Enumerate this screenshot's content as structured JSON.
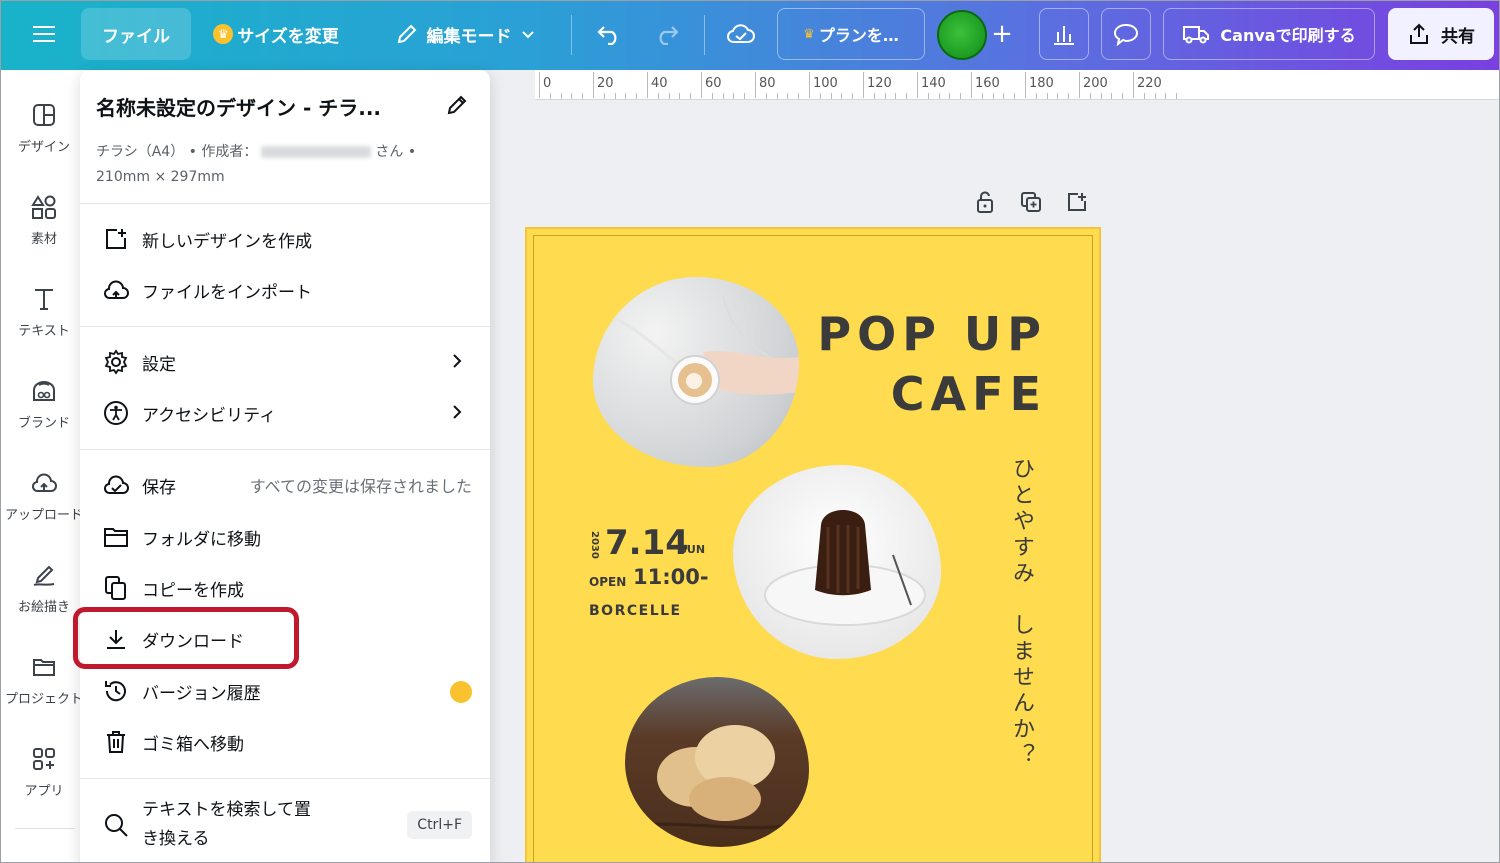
{
  "topbar": {
    "file_label": "ファイル",
    "resize_label": "サイズを変更",
    "edit_mode_label": "編集モード",
    "plan_label": "プランを…",
    "print_label": "Canvaで印刷する",
    "share_label": "共有"
  },
  "rail": {
    "items": [
      {
        "label": "デザイン",
        "icon": "design-icon"
      },
      {
        "label": "素材",
        "icon": "elements-icon"
      },
      {
        "label": "テキスト",
        "icon": "text-icon"
      },
      {
        "label": "ブランド",
        "icon": "brand-icon"
      },
      {
        "label": "アップロード",
        "icon": "upload-icon"
      },
      {
        "label": "お絵描き",
        "icon": "draw-icon"
      },
      {
        "label": "プロジェクト",
        "icon": "project-icon"
      },
      {
        "label": "アプリ",
        "icon": "apps-icon"
      }
    ]
  },
  "ruler": {
    "ticks": [
      "0",
      "20",
      "40",
      "60",
      "80",
      "100",
      "120",
      "140",
      "160",
      "180",
      "200",
      "220"
    ]
  },
  "menu": {
    "title": "名称未設定のデザイン - チラ...",
    "meta_prefix": "チラシ（A4） • 作成者：",
    "meta_suffix": "さん •",
    "meta_size": "210mm × 297mm",
    "items": {
      "new_design": "新しいデザインを作成",
      "import_file": "ファイルをインポート",
      "settings": "設定",
      "accessibility": "アクセシビリティ",
      "save": "保存",
      "save_status": "すべての変更は保存されました",
      "move_folder": "フォルダに移動",
      "make_copy": "コピーを作成",
      "download": "ダウンロード",
      "version_history": "バージョン履歴",
      "trash": "ゴミ箱へ移動",
      "find_replace_line1": "テキストを検索して置",
      "find_replace_line2": "き換える",
      "find_replace_shortcut": "Ctrl+F"
    }
  },
  "design": {
    "title_line1": "POP UP",
    "title_line2": "CAFE",
    "vertical_text": "ひとやすみ　しませんか？",
    "year": "2030",
    "date": "7.14",
    "day": "SUN",
    "open_label": "OPEN",
    "time": "11:00-",
    "venue": "BORCELLE",
    "background_color": "#fedb4f"
  }
}
